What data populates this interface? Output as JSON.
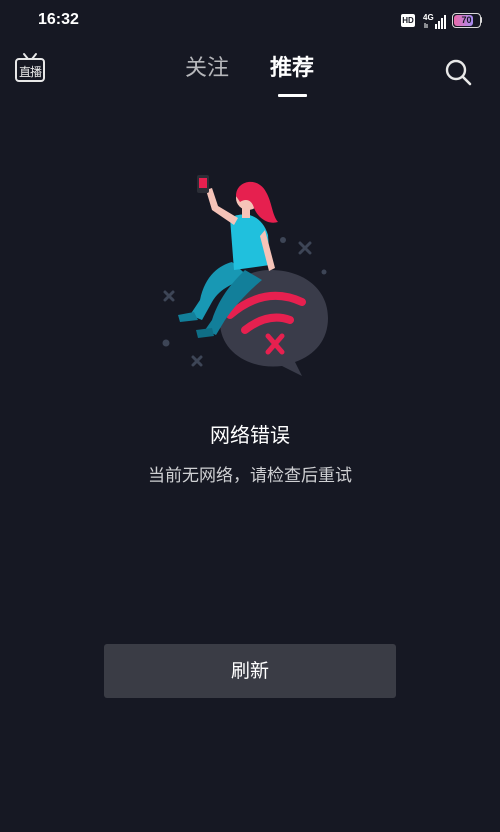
{
  "status_bar": {
    "time": "16:32",
    "hd_label": "HD",
    "network_label": "4G",
    "battery_level": "70",
    "battery_fraction": 0.7
  },
  "top_nav": {
    "live_label": "直播",
    "tabs": [
      {
        "label": "关注",
        "selected": false
      },
      {
        "label": "推荐",
        "selected": true
      }
    ],
    "search_icon": "search-icon",
    "live_icon": "tv-icon"
  },
  "error": {
    "illustration": "no-network-illustration",
    "title": "网络错误",
    "message": "当前无网络，请检查后重试"
  },
  "actions": {
    "refresh_label": "刷新"
  },
  "colors": {
    "background": "#161823",
    "accent": "#e6204f",
    "figure_shirt": "#20c0dd",
    "button_bg": "#3a3c45"
  }
}
